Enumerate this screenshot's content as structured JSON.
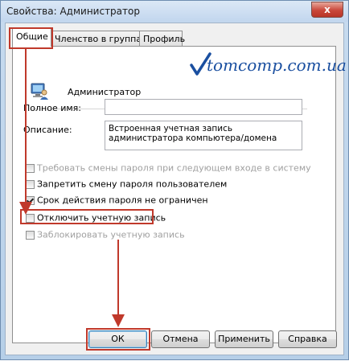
{
  "window": {
    "title": "Свойства: Администратор",
    "close_glyph": "x"
  },
  "tabs": [
    {
      "label": "Общие",
      "active": true
    },
    {
      "label": "Членство в группах",
      "active": false
    },
    {
      "label": "Профиль",
      "active": false
    }
  ],
  "watermark": "tomcomp.com.ua",
  "account": {
    "icon": "user-monitor-icon",
    "name": "Администратор"
  },
  "fields": {
    "full_name_label": "Полное имя:",
    "full_name_value": "",
    "description_label": "Описание:",
    "description_value": "Встроенная учетная запись администратора компьютера/домена"
  },
  "checkboxes": [
    {
      "label": "Требовать смены пароля при следующем входе в систему",
      "checked": false,
      "enabled": false
    },
    {
      "label": "Запретить смену пароля пользователем",
      "checked": false,
      "enabled": true
    },
    {
      "label": "Срок действия пароля не ограничен",
      "checked": true,
      "enabled": true
    },
    {
      "label": "Отключить учетную запись",
      "checked": false,
      "enabled": true
    },
    {
      "label": "Заблокировать учетную запись",
      "checked": false,
      "enabled": false
    }
  ],
  "buttons": {
    "ok": "ОК",
    "cancel": "Отмена",
    "apply": "Применить",
    "help": "Справка"
  },
  "colors": {
    "highlight": "#c0392b",
    "watermark": "#1a4fa0",
    "window_frame": "#b6cfe8"
  }
}
